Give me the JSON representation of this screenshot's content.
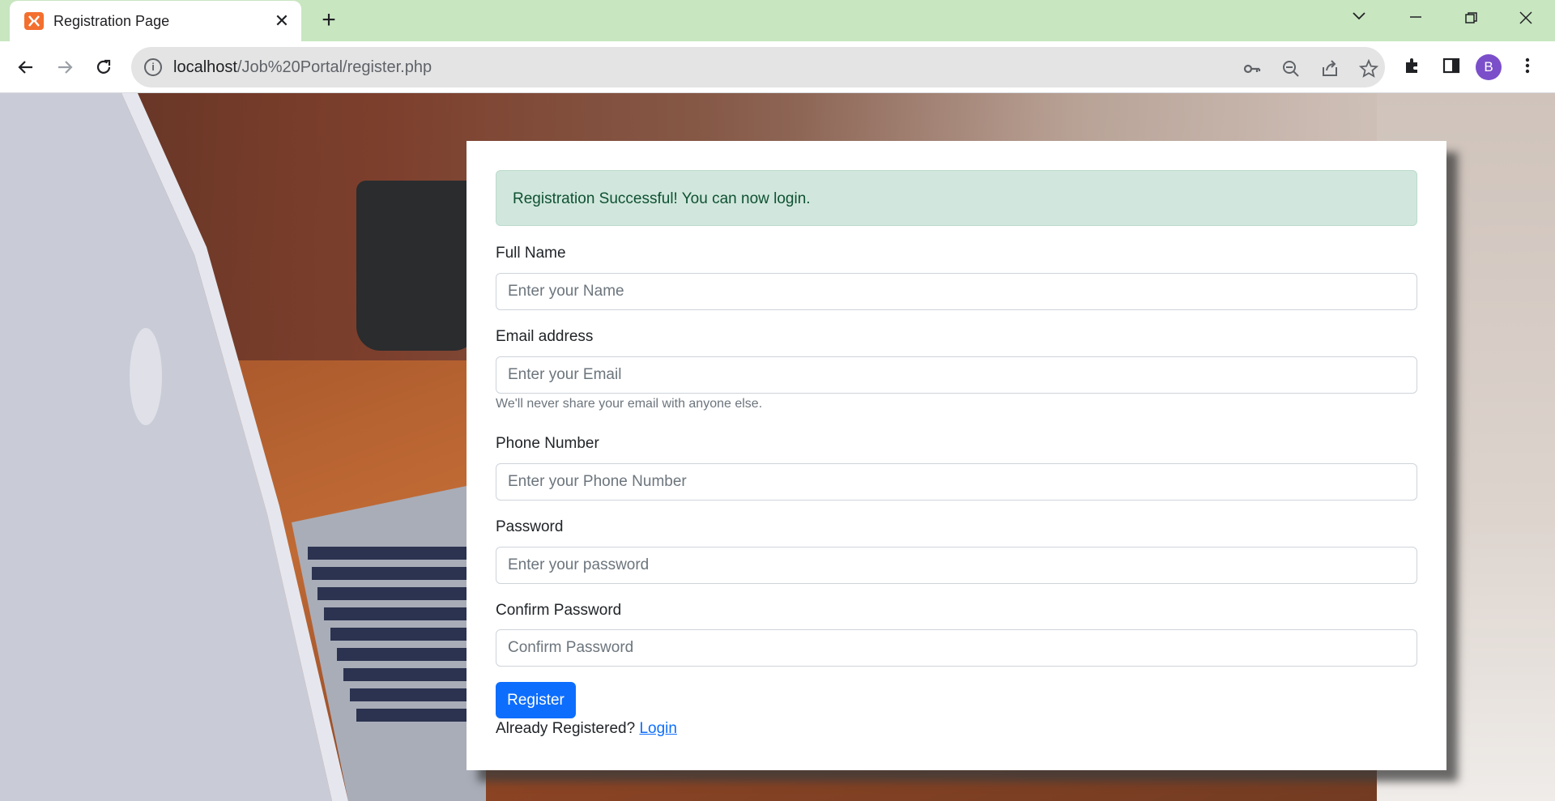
{
  "browser": {
    "tab_title": "Registration Page",
    "url_host": "localhost",
    "url_path": "/Job%20Portal/register.php",
    "profile_initial": "B"
  },
  "alert": {
    "message": "Registration Successful! You can now login."
  },
  "form": {
    "full_name": {
      "label": "Full Name",
      "placeholder": "Enter your Name"
    },
    "email": {
      "label": "Email address",
      "placeholder": "Enter your Email",
      "help": "We'll never share your email with anyone else."
    },
    "phone": {
      "label": "Phone Number",
      "placeholder": "Enter your Phone Number"
    },
    "password": {
      "label": "Password",
      "placeholder": "Enter your password"
    },
    "confirm_password": {
      "label": "Confirm Password",
      "placeholder": "Confirm Password"
    },
    "submit_label": "Register",
    "already_text": "Already Registered?",
    "login_link": "Login"
  },
  "colors": {
    "tabstrip": "#c8e6c0",
    "primary": "#0d6efd",
    "alert_bg": "#d1e7dd",
    "alert_text": "#0f5132"
  }
}
